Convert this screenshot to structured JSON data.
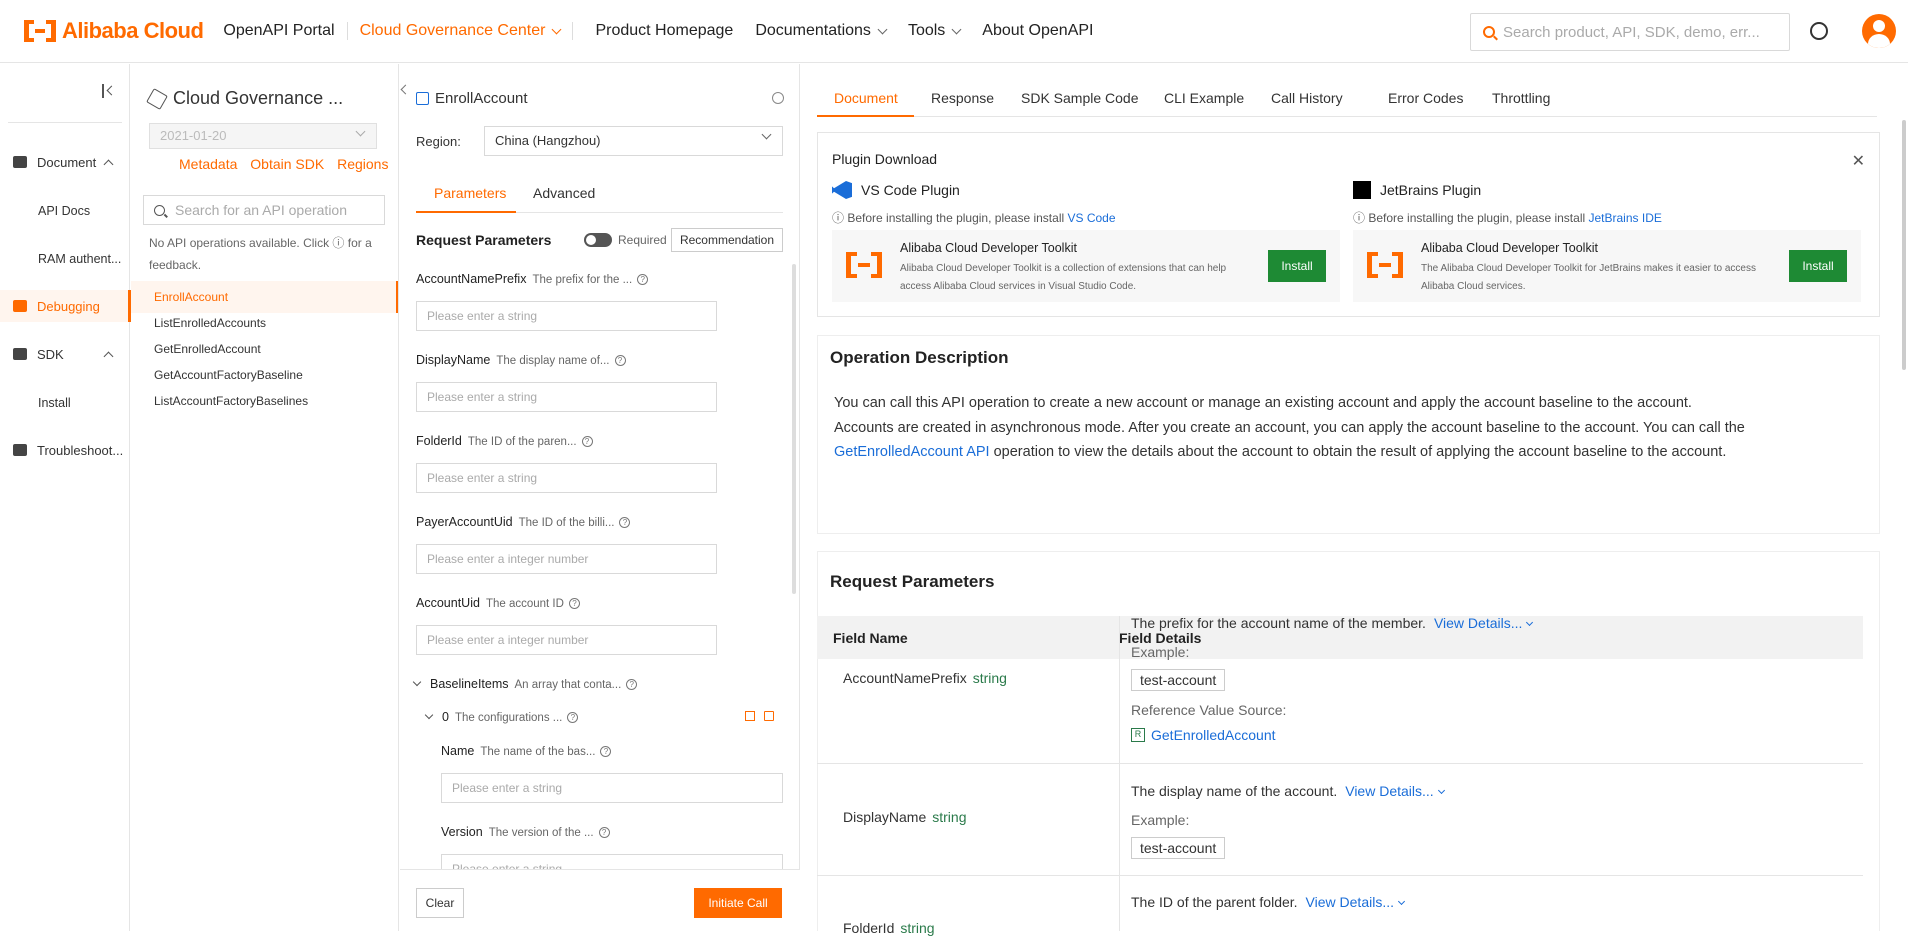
{
  "header": {
    "logo_text": "Alibaba Cloud",
    "nav": [
      "OpenAPI Portal",
      "Cloud Governance Center",
      "Product Homepage",
      "Documentations",
      "Tools",
      "About OpenAPI"
    ],
    "search_placeholder": "Search product, API, SDK, demo, err...",
    "accent": "#ff6a00"
  },
  "leftnav": {
    "items": [
      {
        "label": "Document",
        "icon": "document-icon"
      },
      {
        "label": "API Docs"
      },
      {
        "label": "RAM authent..."
      },
      {
        "label": "Debugging",
        "icon": "debug-icon",
        "active": true
      },
      {
        "label": "SDK",
        "icon": "sdk-icon"
      },
      {
        "label": "Install"
      },
      {
        "label": "Troubleshoot...",
        "icon": "troubleshoot-icon"
      }
    ]
  },
  "apilist": {
    "title": "Cloud Governance ...",
    "version": "2021-01-20",
    "links": [
      "Metadata",
      "Obtain SDK",
      "Regions"
    ],
    "search_placeholder": "Search for an API operation",
    "note": "No API operations available. Click ⓘ for a feedback.",
    "items": [
      "EnrollAccount",
      "ListEnrolledAccounts",
      "GetEnrolledAccount",
      "GetAccountFactoryBaseline",
      "ListAccountFactoryBaselines"
    ]
  },
  "debug": {
    "title": "EnrollAccount",
    "region_label": "Region:",
    "region_value": "China (Hangzhou)",
    "tabs": [
      "Parameters",
      "Advanced"
    ],
    "req_params": "Request Parameters",
    "required_label": "Required",
    "recommendation": "Recommendation",
    "fields": [
      {
        "name": "AccountNamePrefix",
        "desc": "The prefix for the ...",
        "placeholder": "Please enter a string"
      },
      {
        "name": "DisplayName",
        "desc": "The display name of...",
        "placeholder": "Please enter a string"
      },
      {
        "name": "FolderId",
        "desc": "The ID of the paren...",
        "placeholder": "Please enter a string"
      },
      {
        "name": "PayerAccountUid",
        "desc": "The ID of the billi...",
        "placeholder": "Please enter a integer number"
      },
      {
        "name": "AccountUid",
        "desc": "The account ID",
        "placeholder": "Please enter a integer number"
      }
    ],
    "baseline_items": {
      "name": "BaselineItems",
      "desc": "An array that conta..."
    },
    "baseline_index": {
      "name": "0",
      "desc": "The configurations ..."
    },
    "sub_fields": [
      {
        "name": "Name",
        "desc": "The name of the bas...",
        "placeholder": "Please enter a string"
      },
      {
        "name": "Version",
        "desc": "The version of the ...",
        "placeholder": "Please enter a string"
      }
    ],
    "clear": "Clear",
    "initiate": "Initiate Call"
  },
  "doc": {
    "tabs": [
      "Document",
      "Response",
      "SDK Sample Code",
      "CLI Example",
      "Call History",
      "Error Codes",
      "Throttling"
    ],
    "plugin": {
      "title": "Plugin Download",
      "vscode": {
        "name": "VS Code Plugin",
        "note": "Before installing the plugin, please install",
        "link": "VS Code",
        "card_name": "Alibaba Cloud Developer Toolkit",
        "card_desc": "Alibaba Cloud Developer Toolkit is a collection of extensions that can help access Alibaba Cloud services in Visual Studio Code.",
        "install": "Install"
      },
      "jetbrains": {
        "name": "JetBrains Plugin",
        "note": "Before installing the plugin, please install",
        "link": "JetBrains IDE",
        "card_name": "Alibaba Cloud Developer Toolkit",
        "card_desc": "The Alibaba Cloud Developer Toolkit for JetBrains makes it easier to access Alibaba Cloud services.",
        "install": "Install"
      }
    },
    "op_desc_title": "Operation Description",
    "op_desc_1": "You can call this API operation to create a new account or manage an existing account and apply the account baseline to the account.",
    "op_desc_2a": "Accounts are created in asynchronous mode. After you create an account, you can apply the account baseline to the account. You can call the",
    "op_desc_link": "GetEnrolledAccount API",
    "op_desc_2b": "operation to view the details about the account to obtain the result of applying the account baseline to the account.",
    "req_title": "Request Parameters",
    "col_name": "Field Name",
    "col_details": "Field Details",
    "rows": [
      {
        "name": "AccountNamePrefix",
        "type": "string",
        "detail": "The prefix for the account name of the member.",
        "view": "View Details...",
        "example_label": "Example:",
        "example": "test-account",
        "ref_label": "Reference Value Source:",
        "ref": "GetEnrolledAccount"
      },
      {
        "name": "DisplayName",
        "type": "string",
        "detail": "The display name of the account.",
        "view": "View Details...",
        "example_label": "Example:",
        "example": "test-account"
      },
      {
        "name": "FolderId",
        "type": "string",
        "detail": "The ID of the parent folder.",
        "view": "View Details..."
      }
    ]
  }
}
